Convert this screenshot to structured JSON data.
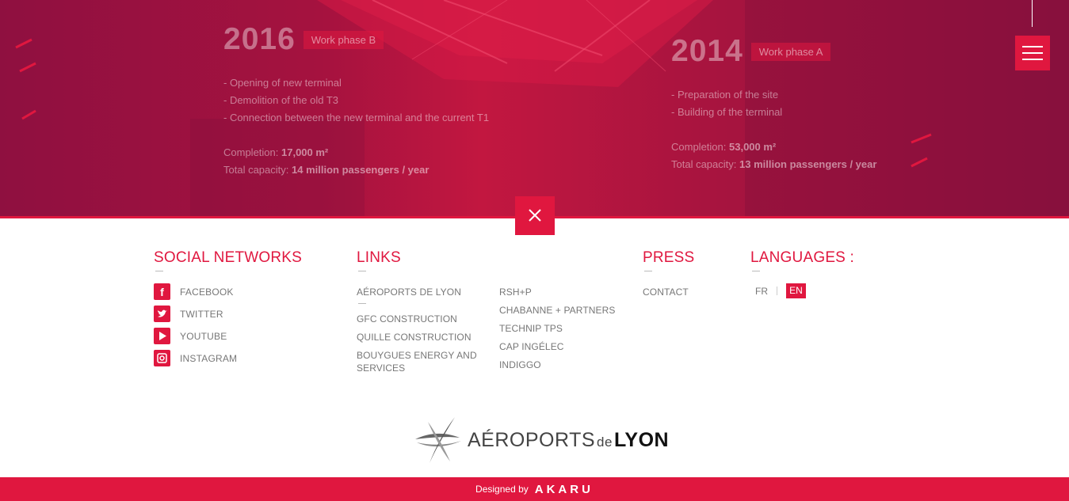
{
  "hero": {
    "phase_b": {
      "year": "2016",
      "tag": "Work phase B",
      "lines": [
        "- Opening of new terminal",
        "- Demolition of the old T3",
        "- Connection between the new terminal and the current T1"
      ],
      "completion_label": "Completion:",
      "completion_value": "17,000 m²",
      "capacity_label": "Total capacity:",
      "capacity_value": "14 million passengers / year"
    },
    "phase_a": {
      "year": "2014",
      "tag": "Work phase A",
      "lines": [
        "- Preparation of the site",
        "- Building of the terminal"
      ],
      "completion_label": "Completion:",
      "completion_value": "53,000 m²",
      "capacity_label": "Total capacity:",
      "capacity_value": "13 million passengers / year"
    }
  },
  "social": {
    "title": "SOCIAL NETWORKS",
    "items": [
      {
        "label": "FACEBOOK",
        "icon": "facebook-icon"
      },
      {
        "label": "TWITTER",
        "icon": "twitter-icon"
      },
      {
        "label": "YOUTUBE",
        "icon": "youtube-icon"
      },
      {
        "label": "INSTAGRAM",
        "icon": "instagram-icon"
      }
    ]
  },
  "links": {
    "title": "LINKS",
    "col1": [
      "AÉROPORTS DE LYON",
      "GFC CONSTRUCTION",
      "QUILLE CONSTRUCTION",
      "BOUYGUES ENERGY AND",
      "SERVICES"
    ],
    "col2": [
      "RSH+P",
      "CHABANNE + PARTNERS",
      "TECHNIP TPS",
      "CAP INGÉLEC",
      "INDIGGO"
    ]
  },
  "press": {
    "title": "PRESS",
    "contact": "CONTACT"
  },
  "languages": {
    "title": "LANGUAGES :",
    "fr": "FR",
    "en": "EN",
    "selected": "EN"
  },
  "logo": {
    "aeroports": "AÉROPORTS",
    "de": "de",
    "lyon": "LYON"
  },
  "footer": {
    "designed_by": "Designed by",
    "agency": "AKARU"
  },
  "colors": {
    "accent": "#e0173f",
    "hero_dark": "#8f1040",
    "text_gray": "#777777"
  }
}
